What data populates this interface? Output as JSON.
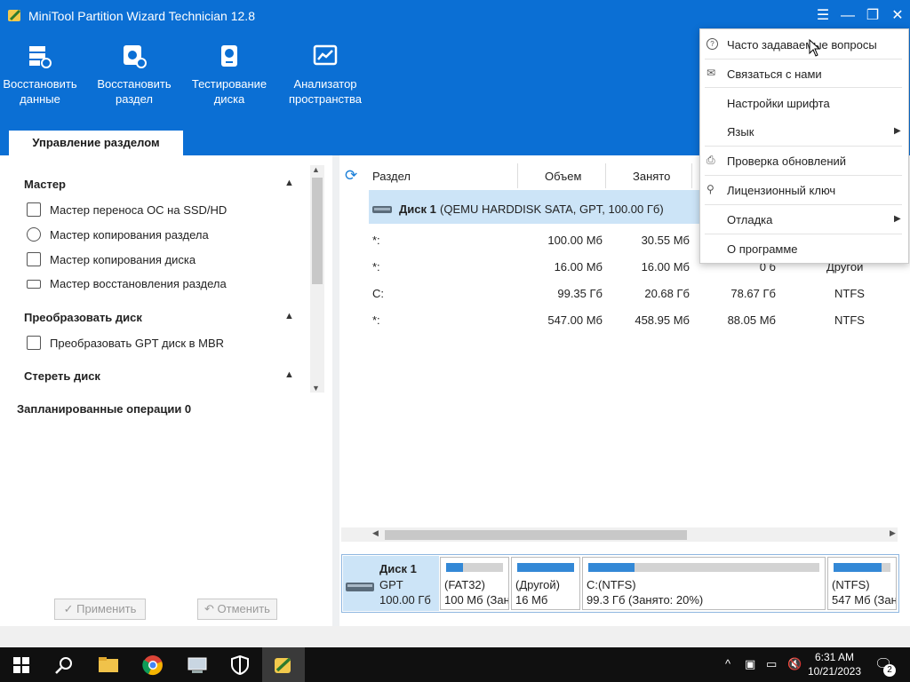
{
  "window": {
    "title": "MiniTool Partition Wizard Technician 12.8",
    "controls": [
      "☰",
      "—",
      "❐",
      "✕"
    ]
  },
  "toolbar": [
    {
      "line1": "Восстановить",
      "line2": "данные",
      "icon": "data-recovery-icon"
    },
    {
      "line1": "Восстановить",
      "line2": "раздел",
      "icon": "partition-recovery-icon"
    },
    {
      "line1": "Тестирование",
      "line2": "диска",
      "icon": "disk-benchmark-icon"
    },
    {
      "line1": "Анализатор",
      "line2": "пространства",
      "icon": "space-analyzer-icon"
    }
  ],
  "tab": {
    "label": "Управление разделом"
  },
  "sidebar": {
    "sections": [
      {
        "title": "Мастер",
        "items": [
          "Мастер переноса ОС на SSD/HD",
          "Мастер копирования раздела",
          "Мастер копирования диска",
          "Мастер восстановления раздела"
        ]
      },
      {
        "title": "Преобразовать диск",
        "items": [
          "Преобразовать GPT диск в MBR"
        ]
      },
      {
        "title": "Стереть диск",
        "items": []
      }
    ],
    "pending": "Запланированные операции 0",
    "apply": "Применить",
    "undo": "Отменить"
  },
  "table": {
    "headers": [
      "Раздел",
      "Объем",
      "Занято"
    ],
    "disk_label": "Диск 1",
    "disk_info": "(QEMU HARDDISK SATA, GPT, 100.00 Гб)",
    "rows": [
      {
        "name": "*:",
        "size": "100.00 Мб",
        "used": "30.55 Мб",
        "unused": "",
        "fs": ""
      },
      {
        "name": "*:",
        "size": "16.00 Мб",
        "used": "16.00 Мб",
        "unused": "0 б",
        "fs": "Другой"
      },
      {
        "name": "C:",
        "size": "99.35 Гб",
        "used": "20.68 Гб",
        "unused": "78.67 Гб",
        "fs": "NTFS"
      },
      {
        "name": "*:",
        "size": "547.00 Мб",
        "used": "458.95 Мб",
        "unused": "88.05 Мб",
        "fs": "NTFS"
      }
    ]
  },
  "diskmap": {
    "disk": {
      "name": "Диск 1",
      "type": "GPT",
      "size": "100.00 Гб"
    },
    "partitions": [
      {
        "fs": "(FAT32)",
        "detail": "100 Мб (Зан",
        "fill": 0.3
      },
      {
        "fs": "(Другой)",
        "detail": "16 Мб",
        "fill": 1.0
      },
      {
        "fs": "C:(NTFS)",
        "detail": "99.3 Гб (Занято: 20%)",
        "fill": 0.2
      },
      {
        "fs": "(NTFS)",
        "detail": "547 Мб (Зан",
        "fill": 0.84
      }
    ]
  },
  "menu": {
    "items": [
      {
        "label": "Часто задаваемые вопросы",
        "icon": "faq-icon"
      },
      {
        "label": "Связаться с нами",
        "icon": "mail-icon"
      },
      {
        "label": "Настройки шрифта",
        "icon": ""
      },
      {
        "label": "Язык",
        "icon": "",
        "submenu": true
      },
      {
        "label": "Проверка обновлений",
        "icon": "update-icon"
      },
      {
        "label": "Лицензионный ключ",
        "icon": "key-user-icon"
      },
      {
        "label": "Отладка",
        "icon": "",
        "submenu": true
      },
      {
        "label": "О программе",
        "icon": ""
      }
    ]
  },
  "taskbar": {
    "time": "6:31 AM",
    "date": "10/21/2023",
    "notification_count": "2"
  },
  "colors": {
    "accent": "#0b6fd4",
    "selected_row": "#cce4f7",
    "partition_fill": "#3388d6"
  }
}
